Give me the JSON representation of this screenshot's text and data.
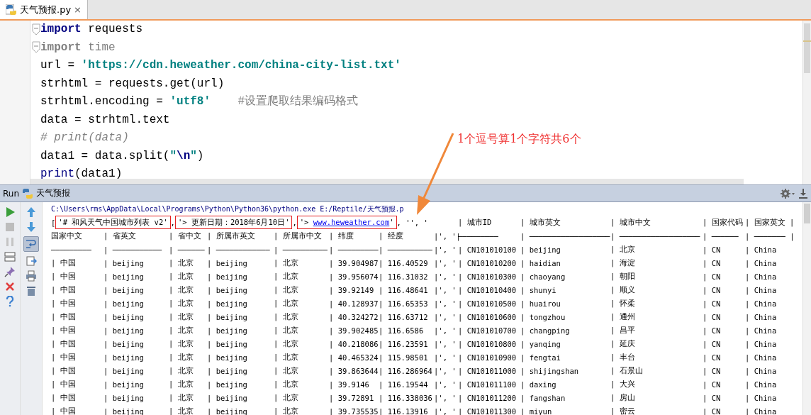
{
  "tab": {
    "label": "天气预报.py",
    "close": "×",
    "selected": true
  },
  "editor": {
    "lines": [
      {
        "tokens": [
          {
            "kind": "keyword",
            "text": "import"
          },
          {
            "kind": "plain",
            "text": " requests"
          }
        ],
        "fold": true
      },
      {
        "tokens": [
          {
            "kind": "keyword_unused",
            "text": "import"
          },
          {
            "kind": "unused",
            "text": " time"
          }
        ],
        "fold": true
      },
      {
        "tokens": [
          {
            "kind": "plain",
            "text": "url = "
          },
          {
            "kind": "string",
            "text": "'https://cdn.heweather.com/china-city-list.txt'"
          }
        ],
        "fold": false
      },
      {
        "tokens": [
          {
            "kind": "plain",
            "text": "strhtml = requests.get(url)"
          }
        ],
        "fold": false
      },
      {
        "tokens": [
          {
            "kind": "plain",
            "text": "strhtml.encoding = "
          },
          {
            "kind": "string",
            "text": "'utf8'"
          },
          {
            "kind": "comment",
            "text": "#设置爬取结果编码格式"
          }
        ],
        "fold": false
      },
      {
        "tokens": [
          {
            "kind": "plain",
            "text": "data = strhtml.text"
          }
        ],
        "fold": false
      },
      {
        "tokens": [
          {
            "kind": "comment_italic",
            "text": "# print(data)"
          }
        ],
        "fold": false
      },
      {
        "tokens": [
          {
            "kind": "plain",
            "text": "data1 = data.split("
          },
          {
            "kind": "string",
            "text": "\""
          },
          {
            "kind": "escape",
            "text": "\\n"
          },
          {
            "kind": "string",
            "text": "\""
          },
          {
            "kind": "plain",
            "text": ")"
          }
        ],
        "fold": false
      },
      {
        "tokens": [
          {
            "kind": "builtin",
            "text": "print"
          },
          {
            "kind": "plain",
            "text": "(data1)"
          }
        ],
        "fold": false
      }
    ]
  },
  "annotation": {
    "text": "1个逗号算1个字符共6个"
  },
  "run_panel": {
    "label": "Run",
    "config": "天气预报"
  },
  "console": {
    "command": "C:\\Users\\rms\\AppData\\Local\\Programs\\Python\\Python36\\python.exe E:/Reptile/天气预报.p",
    "rows": [
      {
        "kind": "mixed",
        "segments": [
          {
            "kind": "plain",
            "text": "["
          },
          {
            "kind": "boxed",
            "parts": [
              {
                "kind": "plain",
                "text": "'# 和风天气中国城市列表 v2'"
              }
            ]
          },
          {
            "kind": "plain",
            "text": ","
          },
          {
            "kind": "boxed",
            "parts": [
              {
                "kind": "plain",
                "text": "'> 更新日期：2018年6月10日'"
              }
            ]
          },
          {
            "kind": "plain",
            "text": ","
          },
          {
            "kind": "boxed",
            "parts": [
              {
                "kind": "plain",
                "text": "'> "
              },
              {
                "kind": "link",
                "text": "www.heweather.com"
              },
              {
                "kind": "plain",
                "text": "'"
              }
            ]
          },
          {
            "kind": "plain",
            "text": ", '', '"
          }
        ],
        "cells": [
          null,
          null,
          null,
          null,
          null,
          null,
          null,
          null,
          "| 城市ID",
          "| 城市英文",
          "| 城市中文",
          "| 国家代码",
          "| 国家英文 |"
        ]
      },
      {
        "kind": "cells",
        "cells": [
          "国家中文",
          "| 省英文",
          "| 省中文",
          "| 所属市英文",
          "| 所属市中文",
          "| 纬度",
          "| 经度",
          "|', '|",
          "─────────",
          "| ──────────────────",
          "| ──────────────────",
          "| ──────",
          "| ─────── |"
        ]
      },
      {
        "kind": "cells",
        "cells": [
          "─────────",
          "| ───────────",
          "| ──────",
          "| ────────────",
          "| ──────────",
          "| ─────────",
          "| ──────────",
          "|', '",
          "| CN101010100",
          "| beijing",
          "| 北京",
          "| CN",
          "| China"
        ]
      },
      {
        "kind": "cells",
        "cells": [
          "| 中国",
          "| beijing",
          "| 北京",
          "| beijing",
          "| 北京",
          "| 39.904987",
          "| 116.40529",
          "|', '",
          "| CN101010200",
          "| haidian",
          "| 海淀",
          "| CN",
          "| China"
        ]
      },
      {
        "kind": "cells",
        "cells": [
          "| 中国",
          "| beijing",
          "| 北京",
          "| beijing",
          "| 北京",
          "| 39.956074",
          "| 116.31032",
          "|', '",
          "| CN101010300",
          "| chaoyang",
          "| 朝阳",
          "| CN",
          "| China"
        ]
      },
      {
        "kind": "cells",
        "cells": [
          "| 中国",
          "| beijing",
          "| 北京",
          "| beijing",
          "| 北京",
          "| 39.92149",
          "| 116.48641",
          "|', '",
          "| CN101010400",
          "| shunyi",
          "| 顺义",
          "| CN",
          "| China"
        ]
      },
      {
        "kind": "cells",
        "cells": [
          "| 中国",
          "| beijing",
          "| 北京",
          "| beijing",
          "| 北京",
          "| 40.128937",
          "| 116.65353",
          "|', '",
          "| CN101010500",
          "| huairou",
          "| 怀柔",
          "| CN",
          "| China"
        ]
      },
      {
        "kind": "cells",
        "cells": [
          "| 中国",
          "| beijing",
          "| 北京",
          "| beijing",
          "| 北京",
          "| 40.324272",
          "| 116.63712",
          "|', '",
          "| CN101010600",
          "| tongzhou",
          "| 通州",
          "| CN",
          "| China"
        ]
      },
      {
        "kind": "cells",
        "cells": [
          "| 中国",
          "| beijing",
          "| 北京",
          "| beijing",
          "| 北京",
          "| 39.902485",
          "| 116.6586",
          "|', '",
          "| CN101010700",
          "| changping",
          "| 昌平",
          "| CN",
          "| China"
        ]
      },
      {
        "kind": "cells",
        "cells": [
          "| 中国",
          "| beijing",
          "| 北京",
          "| beijing",
          "| 北京",
          "| 40.218086",
          "| 116.23591",
          "|', '",
          "| CN101010800",
          "| yanqing",
          "| 延庆",
          "| CN",
          "| China"
        ]
      },
      {
        "kind": "cells",
        "cells": [
          "| 中国",
          "| beijing",
          "| 北京",
          "| beijing",
          "| 北京",
          "| 40.465324",
          "| 115.98501",
          "|', '",
          "| CN101010900",
          "| fengtai",
          "| 丰台",
          "| CN",
          "| China"
        ]
      },
      {
        "kind": "cells",
        "cells": [
          "| 中国",
          "| beijing",
          "| 北京",
          "| beijing",
          "| 北京",
          "| 39.863644",
          "| 116.286964",
          "|', '",
          "| CN101011000",
          "| shijingshan",
          "| 石景山",
          "| CN",
          "| China"
        ]
      },
      {
        "kind": "cells",
        "cells": [
          "| 中国",
          "| beijing",
          "| 北京",
          "| beijing",
          "| 北京",
          "| 39.9146",
          "| 116.19544",
          "|', '",
          "| CN101011100",
          "| daxing",
          "| 大兴",
          "| CN",
          "| China"
        ]
      },
      {
        "kind": "cells",
        "cells": [
          "| 中国",
          "| beijing",
          "| 北京",
          "| beijing",
          "| 北京",
          "| 39.72891",
          "| 116.338036",
          "|', '",
          "| CN101011200",
          "| fangshan",
          "| 房山",
          "| CN",
          "| China"
        ]
      },
      {
        "kind": "cells",
        "cells": [
          "| 中国",
          "| beijing",
          "| 北京",
          "| beijing",
          "| 北京",
          "| 39.735535",
          "| 116.13916",
          "|', '",
          "| CN101011300",
          "| miyun",
          "| 密云",
          "| CN",
          "| China"
        ]
      }
    ]
  }
}
